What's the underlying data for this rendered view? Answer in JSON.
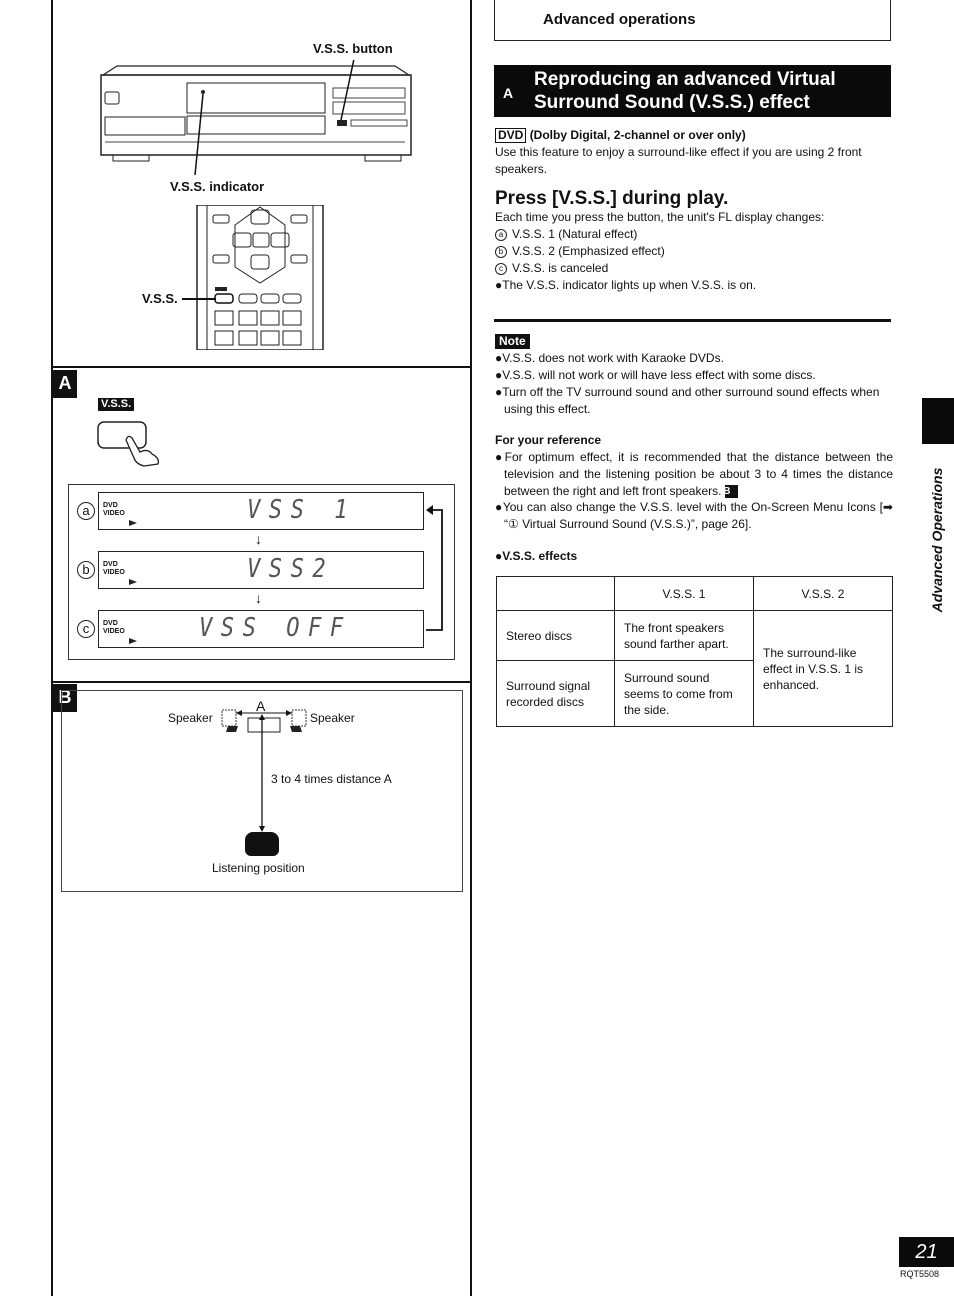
{
  "header": {
    "section": "Advanced operations"
  },
  "title": {
    "letter": "A",
    "line1": "Reproducing an advanced Virtual",
    "line2": "Surround Sound (V.S.S.) effect"
  },
  "intro": {
    "disc_badge": "DVD",
    "condition": "(Dolby Digital, 2-channel or over only)",
    "text": "Use this feature to enjoy a surround-like effect if you are using 2 front speakers."
  },
  "step": {
    "heading": "Press [V.S.S.] during play.",
    "lead": "Each time you press the button, the unit's FL display changes:",
    "options": [
      {
        "mark": "a",
        "text": "V.S.S. 1 (Natural effect)"
      },
      {
        "mark": "b",
        "text": "V.S.S. 2 (Emphasized effect)"
      },
      {
        "mark": "c",
        "text": "V.S.S. is canceled"
      }
    ],
    "bullet": "●The V.S.S. indicator lights up when V.S.S. is on."
  },
  "note": {
    "tag": "Note",
    "items": [
      "●V.S.S. does not work with Karaoke DVDs.",
      "●V.S.S. will not work or will have less effect with some discs.",
      "●Turn off the TV surround sound and other surround sound effects when using this effect."
    ]
  },
  "reference": {
    "heading": "For your reference",
    "item1": "●For optimum effect, it is recommended that the distance between the television and the listening position be about 3 to 4 times the distance between the right and left front speakers.",
    "item1_tag": "B",
    "item2": "●You can also change the V.S.S. level with the On-Screen Menu Icons [➡ “① Virtual Surround Sound (V.S.S.)”, page 26]."
  },
  "effects": {
    "heading": "●V.S.S. effects",
    "columns": [
      "",
      "V.S.S. 1",
      "V.S.S. 2"
    ],
    "rows": [
      {
        "label": "Stereo discs",
        "vss1": "The front speakers sound farther apart."
      },
      {
        "label": "Surround signal recorded discs",
        "vss1": "Surround sound seems to come from the side."
      }
    ],
    "vss2_merged": "The surround-like effect in V.S.S. 1 is enhanced."
  },
  "figure_top": {
    "button_label": "V.S.S. button",
    "indicator_label": "V.S.S. indicator",
    "remote_label": "V.S.S."
  },
  "figure_a": {
    "tag": "A",
    "button_tag": "V.S.S.",
    "displays": [
      {
        "mark": "a",
        "line1": "DVD",
        "line2": "VIDEO",
        "text": "VSS 1"
      },
      {
        "mark": "b",
        "line1": "DVD",
        "line2": "VIDEO",
        "text": "VSS2"
      },
      {
        "mark": "c",
        "line1": "DVD",
        "line2": "VIDEO",
        "text": "VSS OFF"
      }
    ]
  },
  "figure_b": {
    "tag": "B",
    "speaker_left": "Speaker",
    "speaker_right": "Speaker",
    "distance_label": "A",
    "distance_text": "3 to 4 times distance A",
    "listening": "Listening position"
  },
  "side": {
    "label": "Advanced Operations"
  },
  "footer": {
    "page": "21",
    "code": "RQT5508"
  }
}
